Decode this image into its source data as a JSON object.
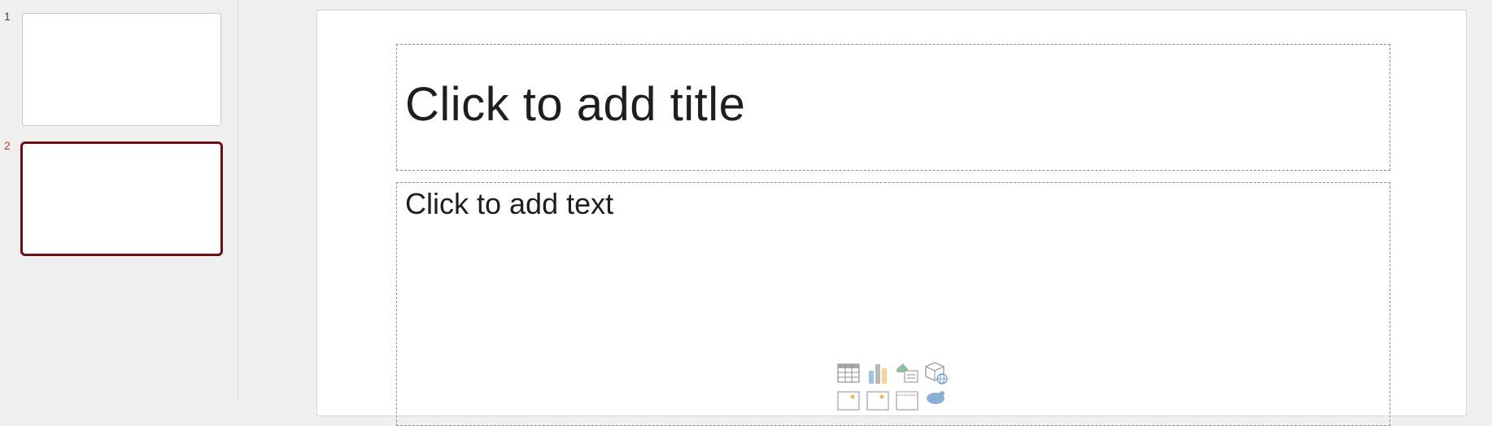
{
  "thumbnails": [
    {
      "number": "1",
      "active": false
    },
    {
      "number": "2",
      "active": true
    }
  ],
  "slide": {
    "title_placeholder": "Click to add title",
    "body_placeholder": "Click to add text"
  },
  "insert_icons": [
    "table-icon",
    "chart-icon",
    "smartart-icon",
    "3d-model-icon",
    "picture-icon",
    "online-picture-icon",
    "video-icon",
    "icons-icon"
  ],
  "colors": {
    "accent": "#6b0f14",
    "active_number": "#c43e1c",
    "pane_bg": "#f0f0f0"
  }
}
